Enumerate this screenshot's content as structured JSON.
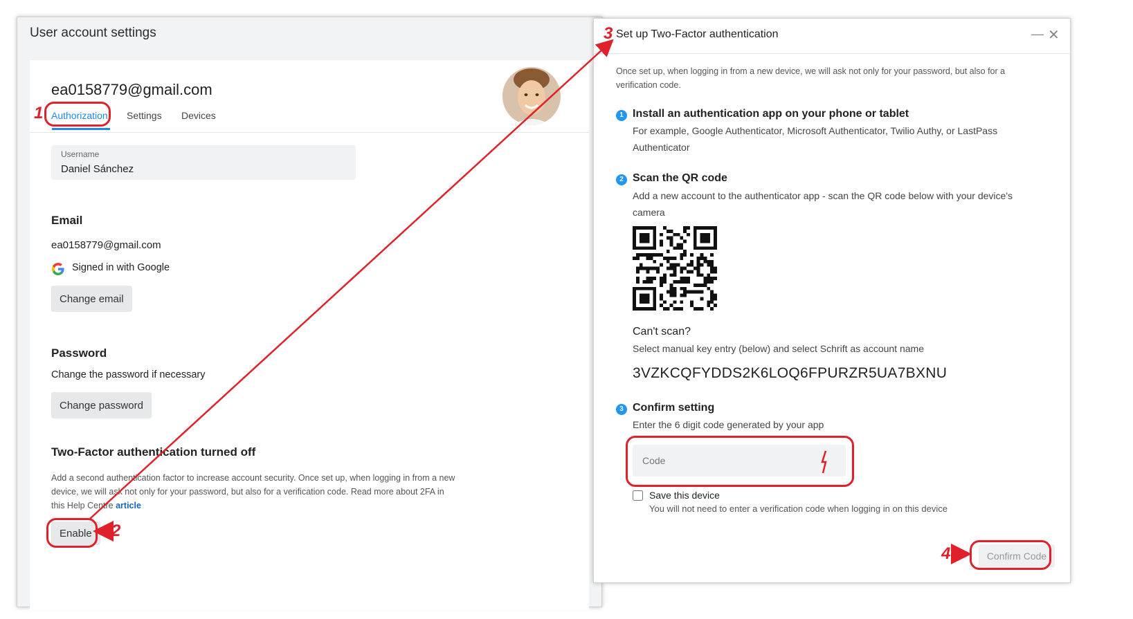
{
  "left_panel": {
    "title": "User account settings",
    "account_email": "ea0158779@gmail.com",
    "tabs": [
      {
        "label": "Authorization",
        "active": true
      },
      {
        "label": "Settings",
        "active": false
      },
      {
        "label": "Devices",
        "active": false
      }
    ],
    "username": {
      "label": "Username",
      "value": "Daniel Sánchez"
    },
    "email_section": {
      "title": "Email",
      "value": "ea0158779@gmail.com",
      "signed_in": "Signed in with Google",
      "button": "Change email"
    },
    "password_section": {
      "title": "Password",
      "desc": "Change the password if necessary",
      "button": "Change password"
    },
    "twofa_section": {
      "title": "Two-Factor authentication turned off",
      "desc": "Add a second authentication factor to increase account security. Once set up, when logging in from a new device, we will ask not only for your password, but also for a verification code. Read more about 2FA in this Help Centre",
      "link": "article",
      "button": "Enable"
    }
  },
  "dialog": {
    "title": "Set up Two-Factor authentication",
    "intro": "Once set up, when logging in from a new device, we will ask not only for your password, but also for a verification code.",
    "steps": [
      {
        "num": "1",
        "title": "Install an authentication app on your phone or tablet",
        "desc": "For example, Google Authenticator, Microsoft Authenticator, Twilio Authy, or LastPass Authenticator"
      },
      {
        "num": "2",
        "title": "Scan the QR code",
        "desc": "Add a new account to the authenticator app - scan the QR code below with your device's camera"
      },
      {
        "num": "3",
        "title": "Confirm setting",
        "desc": "Enter the 6 digit code generated by your app"
      }
    ],
    "cant_scan_title": "Can't scan?",
    "cant_scan_desc": "Select manual key entry (below) and select Schrift as account name",
    "manual_key": "3VZKCQFYDDS2K6LOQ6FPURZR5UA7BXNU",
    "code_placeholder": "Code",
    "save_device_label": "Save this device",
    "save_device_desc": "You will not need to enter a verification code when logging in on this device",
    "confirm_button": "Confirm Code"
  },
  "annotations": {
    "n1": "1",
    "n2": "2",
    "n3": "3",
    "n4": "4",
    "color": "#e0202a"
  }
}
